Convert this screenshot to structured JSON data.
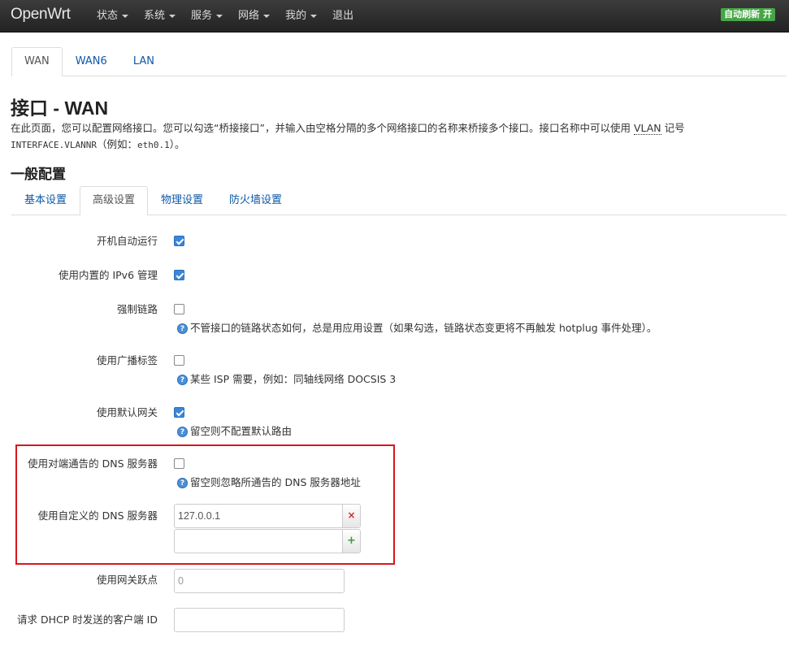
{
  "navbar": {
    "brand": "OpenWrt",
    "menu": [
      {
        "label": "状态",
        "dropdown": true
      },
      {
        "label": "系统",
        "dropdown": true
      },
      {
        "label": "服务",
        "dropdown": true
      },
      {
        "label": "网络",
        "dropdown": true
      },
      {
        "label": "我的",
        "dropdown": true
      },
      {
        "label": "退出",
        "dropdown": false
      }
    ],
    "refresh_badge": "自动刷新 开",
    "refresh_color": "#46a546"
  },
  "interface_tabs": [
    {
      "label": "WAN",
      "active": true
    },
    {
      "label": "WAN6",
      "active": false
    },
    {
      "label": "LAN",
      "active": false
    }
  ],
  "page": {
    "title": "接口 - WAN",
    "desc_line1_before": "在此页面，您可以配置网络接口。您可以勾选“桥接接口”，并输入由空格分隔的多个网络接口的名称来桥接多个接口。接口名称中可以使用 ",
    "desc_vlan": "VLAN",
    "desc_line1_after": " 记号",
    "desc_code": "INTERFACE.VLANNR",
    "desc_line2_mid": "（例如：",
    "desc_code2": "eth0.1",
    "desc_line2_end": "）。",
    "section_title": "一般配置"
  },
  "config_tabs": [
    {
      "label": "基本设置",
      "active": false
    },
    {
      "label": "高级设置",
      "active": true
    },
    {
      "label": "物理设置",
      "active": false
    },
    {
      "label": "防火墙设置",
      "active": false
    }
  ],
  "fields": {
    "auto_start": {
      "label": "开机自动运行",
      "checked": true
    },
    "ipv6_mgmt": {
      "label": "使用内置的 IPv6 管理",
      "checked": true
    },
    "force_link": {
      "label": "强制链路",
      "checked": false,
      "help": "不管接口的链路状态如何，总是用应用设置（如果勾选，链路状态变更将不再触发 hotplug 事件处理）。"
    },
    "broadcast_flag": {
      "label": "使用广播标签",
      "checked": false,
      "help": "某些 ISP 需要，例如：同轴线网络 DOCSIS 3"
    },
    "default_gw": {
      "label": "使用默认网关",
      "checked": true,
      "help": "留空则不配置默认路由"
    },
    "peer_dns": {
      "label": "使用对端通告的 DNS 服务器",
      "checked": false,
      "help": "留空则忽略所通告的 DNS 服务器地址"
    },
    "custom_dns": {
      "label": "使用自定义的 DNS 服务器",
      "values": [
        "127.0.0.1",
        ""
      ],
      "remove_symbol": "×",
      "add_symbol": "+"
    },
    "gw_metric": {
      "label": "使用网关跃点",
      "placeholder": "0"
    },
    "dhcp_client_id": {
      "label": "请求 DHCP 时发送的客户端 ID",
      "value": ""
    }
  },
  "highlight_color": "#d9161c",
  "help_icon_glyph": "?"
}
